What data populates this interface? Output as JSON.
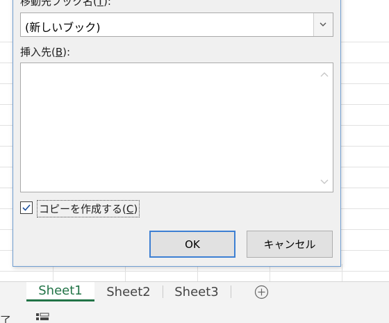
{
  "dialog": {
    "book_label_prefix": "移動先ブック名(",
    "book_label_key": "T",
    "book_label_suffix": "):",
    "book_select_value": "(新しいブック)",
    "before_label_prefix": "挿入先(",
    "before_label_key": "B",
    "before_label_suffix": "):",
    "create_copy_prefix": "コピーを作成する(",
    "create_copy_key": "C",
    "create_copy_suffix": ")",
    "create_copy_checked": true,
    "ok_label": "OK",
    "cancel_label": "キャンセル"
  },
  "sheet_tabs": [
    {
      "label": "Sheet1",
      "active": true
    },
    {
      "label": "Sheet2",
      "active": false
    },
    {
      "label": "Sheet3",
      "active": false
    }
  ],
  "status_bar": {
    "text": "了"
  },
  "colors": {
    "accent": "#217346",
    "focus": "#3c7fd3"
  }
}
